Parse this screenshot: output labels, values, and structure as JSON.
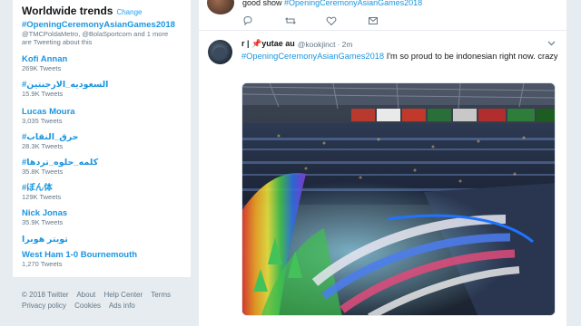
{
  "trends": {
    "title": "Worldwide trends",
    "change_label": "Change",
    "items": [
      {
        "name": "#OpeningCeremonyAsianGames2018",
        "sub": "@TMCPoldaMetro, @BolaSportcom and 1 more",
        "sub2": "are Tweeting about this"
      },
      {
        "name": "Kofi Annan",
        "sub": "269K Tweets"
      },
      {
        "name": "#السعوديه_الارجنتين",
        "sub": "15.9K Tweets"
      },
      {
        "name": "Lucas Moura",
        "sub": "3,035 Tweets"
      },
      {
        "name": "#حرق_النقاب",
        "sub": "28.3K Tweets"
      },
      {
        "name": "#كلمه_حلوه_تردها",
        "sub": "35.8K Tweets"
      },
      {
        "name": "#ぼん体",
        "sub": "129K Tweets"
      },
      {
        "name": "Nick Jonas",
        "sub": "35.9K Tweets"
      },
      {
        "name": "تويتر هوبرا",
        "sub": ""
      },
      {
        "name": "West Ham 1-0 Bournemouth",
        "sub": "1,270 Tweets"
      }
    ]
  },
  "footer": {
    "line1": [
      "© 2018 Twitter",
      "About",
      "Help Center",
      "Terms"
    ],
    "line2": [
      "Privacy policy",
      "Cookies",
      "Ads info"
    ]
  },
  "prev_tweet": {
    "text_plain": "good show ",
    "hashtag": "#OpeningCeremonyAsianGames2018"
  },
  "tweet": {
    "name": "r | 📌yutae au",
    "handle": "@kookjinct",
    "time": "· 2m",
    "hashtag": "#OpeningCeremonyAsianGames2018",
    "text": " I'm so proud to be indonesian right now. crazy"
  },
  "colors": {
    "accent": "#1da1f2",
    "link": "#1b95e0",
    "muted": "#657786",
    "background": "#e6ecf0"
  }
}
